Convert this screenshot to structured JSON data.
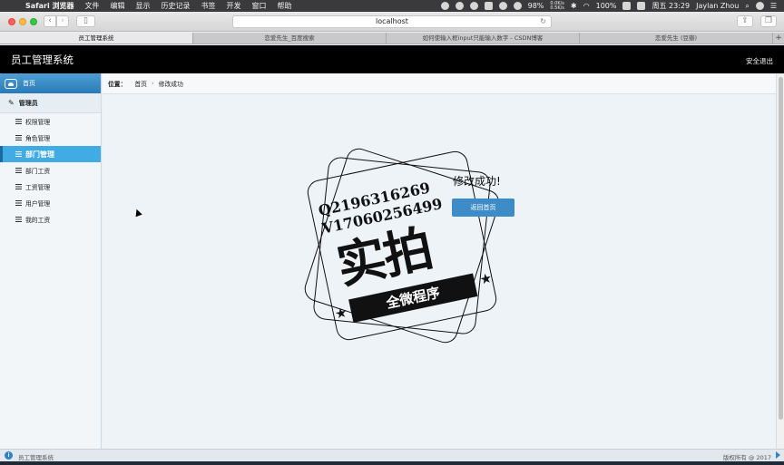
{
  "menubar": {
    "app": "Safari 浏览器",
    "items": [
      "文件",
      "编辑",
      "显示",
      "历史记录",
      "书签",
      "开发",
      "窗口",
      "帮助"
    ],
    "cpu": "98%",
    "net_up": "0.0K/s",
    "net_down": "0.5K/s",
    "battery": "100%",
    "clock": "周五 23:29",
    "user": "Jaylan Zhou"
  },
  "browser": {
    "url": "localhost",
    "tabs": [
      {
        "label": "员工管理系统"
      },
      {
        "label": "恋爱先生_百度搜索"
      },
      {
        "label": "如何使输入框input只能输入数字 - CSDN博客"
      },
      {
        "label": "恋爱先生 (豆瓣)"
      }
    ]
  },
  "header": {
    "title": "员工管理系统",
    "logout": "安全退出"
  },
  "sidebar": {
    "home": "首页",
    "group": "管理员",
    "items": [
      {
        "label": "权限管理"
      },
      {
        "label": "角色管理"
      },
      {
        "label": "部门管理"
      },
      {
        "label": "部门工资"
      },
      {
        "label": "工资管理"
      },
      {
        "label": "用户管理"
      },
      {
        "label": "我的工资"
      }
    ]
  },
  "breadcrumb": {
    "label": "位置：",
    "home": "首页",
    "current": "修改成功"
  },
  "content": {
    "message": "修改成功!",
    "back_button": "返回首页"
  },
  "watermark": {
    "line1": "Q2196316269",
    "line2": "V17060256499",
    "big": "实拍",
    "ribbon": "全微程序"
  },
  "footer": {
    "title": "员工管理系统",
    "copyright": "版权所有 @ 2017"
  }
}
